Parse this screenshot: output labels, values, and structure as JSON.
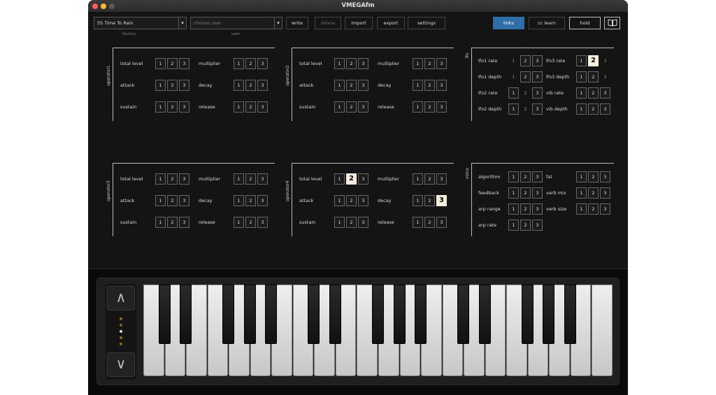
{
  "window": {
    "title": "VMEGAfm"
  },
  "toolbar": {
    "factory_preset": "55  Time To Rain",
    "factory_label": "factory",
    "user_placeholder": "choose user",
    "user_label": "user",
    "dropdown_arrow": "▾",
    "write": "write",
    "delete": "delete",
    "import": "import",
    "export": "export",
    "settings": "settings",
    "links": "links",
    "cc_learn": "cc learn",
    "hold": "hold",
    "book_icon": "book-icon",
    "accent_color": "#2f6fa8"
  },
  "operators": [
    {
      "title": "operator1",
      "params": [
        {
          "label": "total level",
          "value": null
        },
        {
          "label": "multiplier",
          "value": null
        },
        {
          "label": "attack",
          "value": null
        },
        {
          "label": "decay",
          "value": null
        },
        {
          "label": "sustain",
          "value": null
        },
        {
          "label": "release",
          "value": null
        }
      ]
    },
    {
      "title": "operator2",
      "params": [
        {
          "label": "total level",
          "value": null
        },
        {
          "label": "multiplier",
          "value": null
        },
        {
          "label": "attack",
          "value": null
        },
        {
          "label": "decay",
          "value": null
        },
        {
          "label": "sustain",
          "value": null
        },
        {
          "label": "release",
          "value": null
        }
      ]
    },
    {
      "title": "operator3",
      "params": [
        {
          "label": "total level",
          "value": null
        },
        {
          "label": "multiplier",
          "value": null
        },
        {
          "label": "attack",
          "value": null
        },
        {
          "label": "decay",
          "value": null
        },
        {
          "label": "sustain",
          "value": null
        },
        {
          "label": "release",
          "value": null
        }
      ]
    },
    {
      "title": "operator4",
      "params": [
        {
          "label": "total level",
          "value": 2
        },
        {
          "label": "multiplier",
          "value": null
        },
        {
          "label": "attack",
          "value": null
        },
        {
          "label": "decay",
          "value": 3
        },
        {
          "label": "sustain",
          "value": null
        },
        {
          "label": "release",
          "value": null
        }
      ]
    }
  ],
  "lfo": {
    "title": "lfo",
    "params": [
      {
        "label": "lfo1 rate",
        "value": null,
        "dim": [
          1
        ]
      },
      {
        "label": "lfo3 rate",
        "value": 2,
        "dim": [
          3
        ]
      },
      {
        "label": "lfo1 depth",
        "value": null,
        "dim": [
          1
        ]
      },
      {
        "label": "lfo3 depth",
        "value": null,
        "dim": [
          3
        ]
      },
      {
        "label": "lfo2 rate",
        "value": null,
        "dim": [
          2
        ]
      },
      {
        "label": "vib rate",
        "value": null,
        "dim": []
      },
      {
        "label": "lfo2 depth",
        "value": null,
        "dim": [
          2
        ]
      },
      {
        "label": "vib depth",
        "value": null,
        "dim": []
      }
    ]
  },
  "voice": {
    "title": "voice",
    "params": [
      {
        "label": "algorithm",
        "value": null
      },
      {
        "label": "fat",
        "value": null
      },
      {
        "label": "feedback",
        "value": null
      },
      {
        "label": "verb mix",
        "value": null
      },
      {
        "label": "arp range",
        "value": null
      },
      {
        "label": "verb size",
        "value": null
      },
      {
        "label": "arp rate",
        "value": null
      }
    ]
  },
  "selector_options": [
    "1",
    "2",
    "3"
  ],
  "keyboard": {
    "octave_up": "∧",
    "octave_down": "∨",
    "octave_indicator": {
      "count": 5,
      "active": 2
    },
    "white_keys": 22
  }
}
